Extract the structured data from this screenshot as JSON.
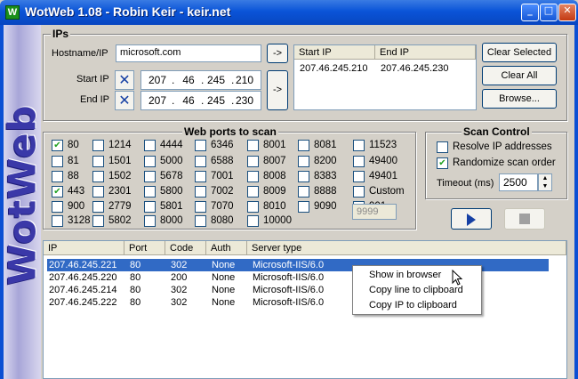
{
  "window": {
    "title": "WotWeb 1.08 - Robin Keir - keir.net",
    "logo_text": "WotWeb"
  },
  "ips": {
    "group_title": "IPs",
    "hostname_label": "Hostname/IP",
    "hostname_value": "microsoft.com",
    "arrow_label": "->",
    "start_ip_label": "Start IP",
    "end_ip_label": "End IP",
    "start_ip": [
      "207",
      "46",
      "245",
      "210"
    ],
    "end_ip": [
      "207",
      "46",
      "245",
      "230"
    ],
    "range_list": {
      "headers": [
        "Start IP",
        "End IP"
      ],
      "rows": [
        [
          "207.46.245.210",
          "207.46.245.230"
        ]
      ]
    },
    "clear_selected": "Clear Selected",
    "clear_all": "Clear All",
    "browse": "Browse..."
  },
  "ports": {
    "group_title": "Web ports to scan",
    "items": [
      {
        "label": "80",
        "checked": true
      },
      {
        "label": "1214",
        "checked": false
      },
      {
        "label": "4444",
        "checked": false
      },
      {
        "label": "6346",
        "checked": false
      },
      {
        "label": "8001",
        "checked": false
      },
      {
        "label": "8081",
        "checked": false
      },
      {
        "label": "11523",
        "checked": false
      },
      {
        "label": "81",
        "checked": false
      },
      {
        "label": "1501",
        "checked": false
      },
      {
        "label": "5000",
        "checked": false
      },
      {
        "label": "6588",
        "checked": false
      },
      {
        "label": "8007",
        "checked": false
      },
      {
        "label": "8200",
        "checked": false
      },
      {
        "label": "49400",
        "checked": false
      },
      {
        "label": "88",
        "checked": false
      },
      {
        "label": "1502",
        "checked": false
      },
      {
        "label": "5678",
        "checked": false
      },
      {
        "label": "7001",
        "checked": false
      },
      {
        "label": "8008",
        "checked": false
      },
      {
        "label": "8383",
        "checked": false
      },
      {
        "label": "49401",
        "checked": false
      },
      {
        "label": "443",
        "checked": true
      },
      {
        "label": "2301",
        "checked": false
      },
      {
        "label": "5800",
        "checked": false
      },
      {
        "label": "7002",
        "checked": false
      },
      {
        "label": "8009",
        "checked": false
      },
      {
        "label": "8888",
        "checked": false
      },
      {
        "label": "Custom",
        "checked": false
      },
      {
        "label": "900",
        "checked": false
      },
      {
        "label": "2779",
        "checked": false
      },
      {
        "label": "5801",
        "checked": false
      },
      {
        "label": "7070",
        "checked": false
      },
      {
        "label": "8010",
        "checked": false
      },
      {
        "label": "9090",
        "checked": false
      },
      {
        "label": "901",
        "checked": false
      },
      {
        "label": "3128",
        "checked": false
      },
      {
        "label": "5802",
        "checked": false
      },
      {
        "label": "8000",
        "checked": false
      },
      {
        "label": "8080",
        "checked": false
      },
      {
        "label": "10000",
        "checked": false
      }
    ],
    "custom_value": "9999"
  },
  "scan": {
    "group_title": "Scan Control",
    "resolve_label": "Resolve IP addresses",
    "resolve_checked": false,
    "randomize_label": "Randomize scan order",
    "randomize_checked": true,
    "timeout_label": "Timeout (ms)",
    "timeout_value": "2500"
  },
  "results": {
    "headers": [
      "IP",
      "Port",
      "Code",
      "Auth",
      "Server type"
    ],
    "rows": [
      {
        "ip": "207.46.245.221",
        "port": "80",
        "code": "302",
        "auth": "None",
        "server": "Microsoft-IIS/6.0",
        "selected": true
      },
      {
        "ip": "207.46.245.220",
        "port": "80",
        "code": "200",
        "auth": "None",
        "server": "Microsoft-IIS/6.0",
        "selected": false
      },
      {
        "ip": "207.46.245.214",
        "port": "80",
        "code": "302",
        "auth": "None",
        "server": "Microsoft-IIS/6.0",
        "selected": false
      },
      {
        "ip": "207.46.245.222",
        "port": "80",
        "code": "302",
        "auth": "None",
        "server": "Microsoft-IIS/6.0",
        "selected": false
      }
    ]
  },
  "context_menu": {
    "items": [
      "Show in browser",
      "Copy line to clipboard",
      "Copy IP to clipboard"
    ]
  },
  "colors": {
    "title_blue": "#0a54d8",
    "selection": "#316ac5",
    "check_green": "#21a121",
    "logo": "#3a38a8"
  }
}
